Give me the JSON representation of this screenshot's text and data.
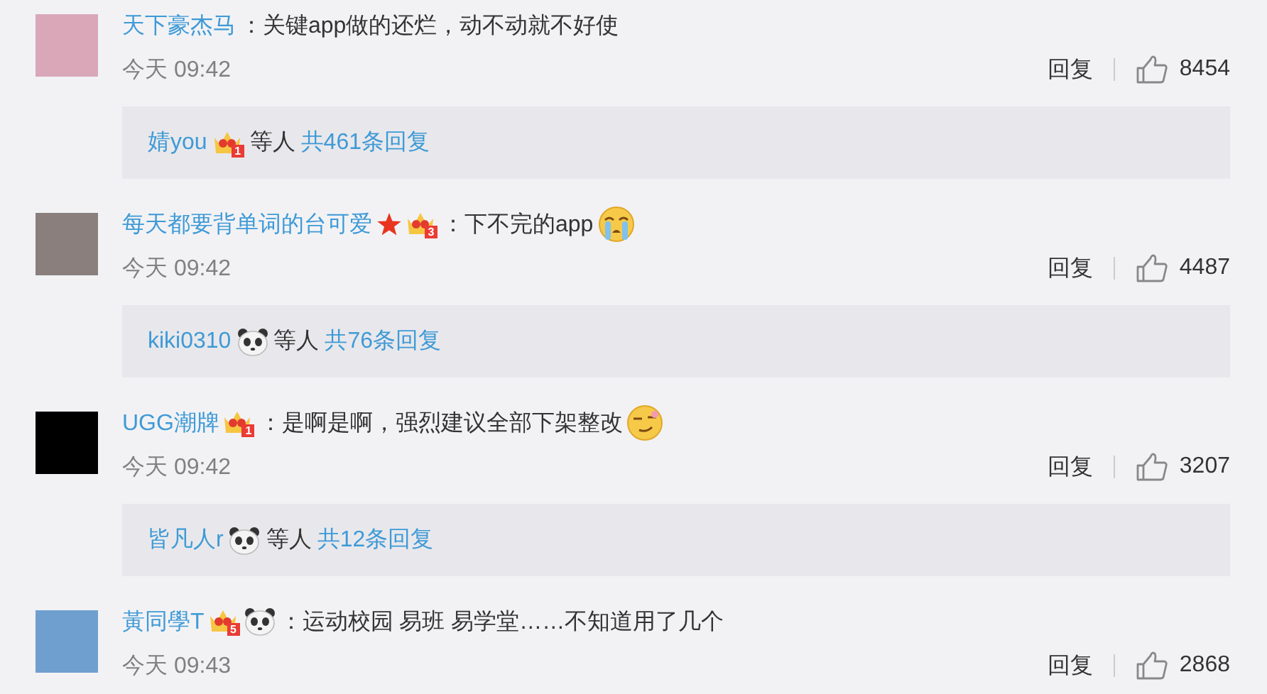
{
  "comments": [
    {
      "avatar": {
        "color": "#d9a7b8"
      },
      "user": "天下豪杰马",
      "text": "：关键app做的还烂，动不动就不好使",
      "time": "今天 09:42",
      "reply_label": "回复",
      "likes": "8454",
      "replies": {
        "user": "婧you",
        "badges": [
          {
            "kind": "crown",
            "level": "1"
          }
        ],
        "suffix": "等人",
        "count": "共461条回复"
      }
    },
    {
      "avatar": {
        "color": "#8a7f7c"
      },
      "user": "每天都要背单词的台可爱",
      "badges": [
        {
          "kind": "star"
        },
        {
          "kind": "crown",
          "level": "3"
        }
      ],
      "text": "：下不完的app",
      "emoji": [
        {
          "kind": "crying"
        }
      ],
      "time": "今天 09:42",
      "reply_label": "回复",
      "likes": "4487",
      "replies": {
        "user": "kiki0310",
        "badges": [
          {
            "kind": "panda"
          }
        ],
        "suffix": "等人",
        "count": "共76条回复"
      }
    },
    {
      "avatar": {
        "color": "#000000"
      },
      "user": "UGG潮牌",
      "badges": [
        {
          "kind": "crown",
          "level": "1"
        }
      ],
      "text": "：是啊是啊，强烈建议全部下架整改",
      "emoji": [
        {
          "kind": "smirk"
        }
      ],
      "time": "今天 09:42",
      "reply_label": "回复",
      "likes": "3207",
      "replies": {
        "user": "皆凡人r",
        "badges": [
          {
            "kind": "panda"
          }
        ],
        "suffix": "等人",
        "count": "共12条回复"
      }
    },
    {
      "avatar": {
        "color": "#6f9fcf"
      },
      "user": "黃同學T",
      "badges": [
        {
          "kind": "crown",
          "level": "5"
        },
        {
          "kind": "panda"
        }
      ],
      "text": "：运动校园 易班 易学堂……不知道用了几个",
      "time": "今天 09:43",
      "reply_label": "回复",
      "likes": "2868"
    }
  ]
}
